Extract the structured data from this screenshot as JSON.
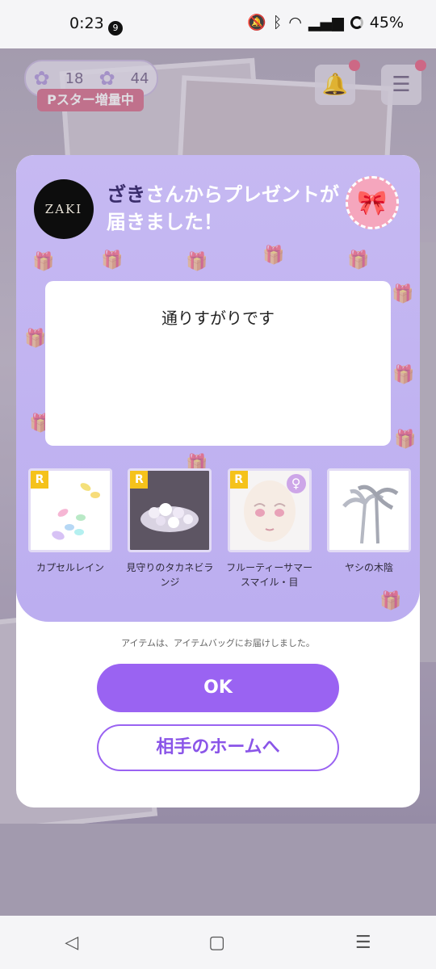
{
  "status_bar": {
    "time": "0:23",
    "notification_count": "9",
    "battery": "45%"
  },
  "background": {
    "stars_left": "18",
    "stars_right": "44",
    "pstar_banner": "Pスター増量中"
  },
  "modal": {
    "sender_avatar_text": "ZAKI",
    "sender_name": "ざき",
    "title_suffix": "さんからプレゼントが届きました！",
    "message": "通りすがりです",
    "items": [
      {
        "label": "カプセルレイン",
        "rarity": "R"
      },
      {
        "label": "見守りのタカネビランジ",
        "rarity": "R"
      },
      {
        "label": "フルーティーサマースマイル・目",
        "rarity": "R",
        "gender": "♀"
      },
      {
        "label": "ヤシの木陰",
        "rarity": ""
      }
    ],
    "delivered_note": "アイテムは、アイテムバッグにお届けしました。",
    "ok_button": "OK",
    "home_button": "相手のホームへ"
  },
  "colors": {
    "accent": "#9a63f2",
    "panel": "#c0b2f0",
    "rarity": "#f5c21b"
  }
}
